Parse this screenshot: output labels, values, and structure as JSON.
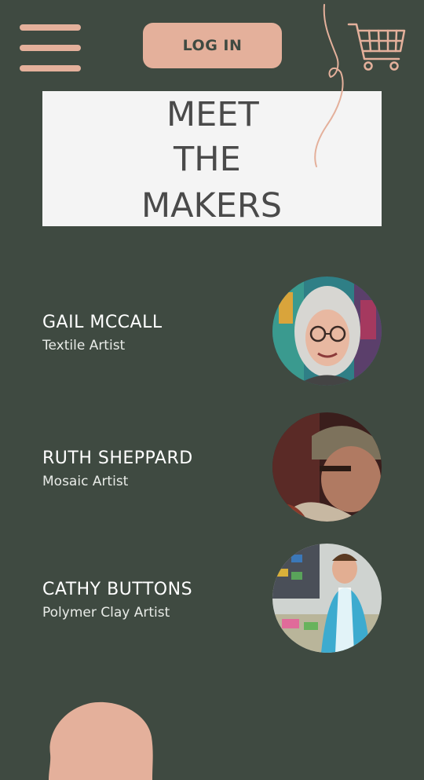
{
  "header": {
    "login_label": "LOG IN"
  },
  "title": {
    "line1": "MEET",
    "line2": "THE",
    "line3": "MAKERS"
  },
  "makers": [
    {
      "name": "GAIL MCCALL",
      "role": "Textile Artist"
    },
    {
      "name": "RUTH SHEPPARD",
      "role": "Mosaic Artist"
    },
    {
      "name": "CATHY BUTTONS",
      "role": "Polymer Clay Artist"
    }
  ],
  "colors": {
    "background": "#3f4a41",
    "accent": "#e4b09b",
    "card": "#f4f4f4",
    "title_text": "#4a4a4a"
  },
  "icons": {
    "menu": "hamburger-menu-icon",
    "cart": "shopping-cart-icon"
  }
}
